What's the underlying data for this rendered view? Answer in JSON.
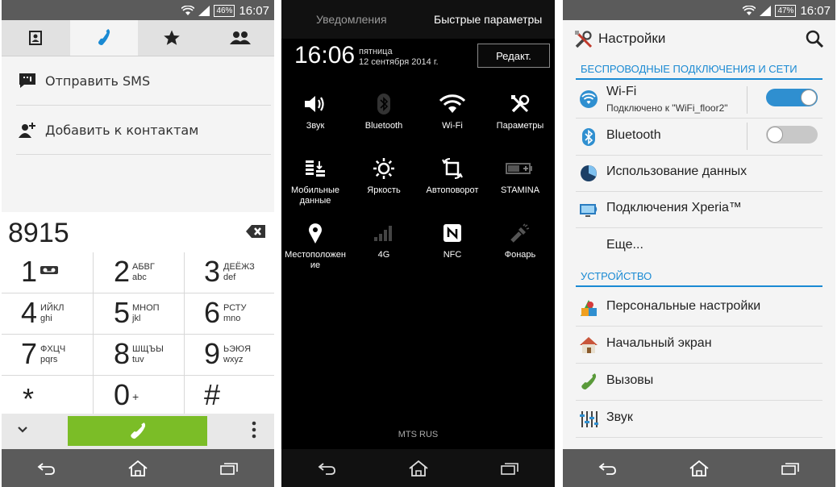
{
  "status": {
    "left": {
      "time": "16:07",
      "battery": "46%"
    },
    "right": {
      "time": "16:07",
      "battery": "47%"
    }
  },
  "dialer": {
    "tabs": [
      "contacts-icon",
      "phone-icon",
      "star-icon",
      "group-icon"
    ],
    "active_tab": "phone-icon",
    "actions": [
      {
        "label": "Отправить SMS",
        "icon": "sms-icon"
      },
      {
        "label": "Добавить к контактам",
        "icon": "add-contact-icon"
      }
    ],
    "number": "8915",
    "keys": [
      {
        "digit": "1",
        "letters": "",
        "extra": "voicemail-icon"
      },
      {
        "digit": "2",
        "letters": "АБВГ\nabc"
      },
      {
        "digit": "3",
        "letters": "ДЕЁЖЗ\ndef"
      },
      {
        "digit": "4",
        "letters": "ИЙКЛ\nghi"
      },
      {
        "digit": "5",
        "letters": "МНОП\njkl"
      },
      {
        "digit": "6",
        "letters": "РСТУ\nmno"
      },
      {
        "digit": "7",
        "letters": "ФХЦЧ\npqrs"
      },
      {
        "digit": "8",
        "letters": "ШЩЪЫ\ntuv"
      },
      {
        "digit": "9",
        "letters": "ЬЭЮЯ\nwxyz"
      },
      {
        "digit": "*",
        "letters": ""
      },
      {
        "digit": "0",
        "letters": "",
        "extra": "+"
      },
      {
        "digit": "#",
        "letters": ""
      }
    ],
    "call_color": "#7bbd27"
  },
  "quick": {
    "tab_notifications": "Уведомления",
    "tab_quick": "Быстрые параметры",
    "clock": "16:06",
    "weekday": "пятница",
    "date": "12 сентября 2014 г.",
    "edit": "Редакт.",
    "tiles": [
      {
        "label": "Звук",
        "icon": "volume-icon",
        "enabled": true
      },
      {
        "label": "Bluetooth",
        "icon": "bluetooth-icon",
        "enabled": false
      },
      {
        "label": "Wi-Fi",
        "icon": "wifi-icon",
        "enabled": true
      },
      {
        "label": "Параметры",
        "icon": "tools-icon",
        "enabled": true
      },
      {
        "label": "Мобильные\nданные",
        "icon": "mobile-data-icon",
        "enabled": true
      },
      {
        "label": "Яркость",
        "icon": "brightness-icon",
        "enabled": true
      },
      {
        "label": "Автоповорот",
        "icon": "rotate-icon",
        "enabled": true
      },
      {
        "label": "STAMINA",
        "icon": "battery-icon",
        "enabled": false
      },
      {
        "label": "Местоположен\nие",
        "icon": "location-icon",
        "enabled": true
      },
      {
        "label": "4G",
        "icon": "signal-icon",
        "enabled": false
      },
      {
        "label": "NFC",
        "icon": "nfc-icon",
        "enabled": true
      },
      {
        "label": "Фонарь",
        "icon": "flashlight-icon",
        "enabled": false
      }
    ],
    "operator": "MTS RUS"
  },
  "settings": {
    "title": "Настройки",
    "section_wireless": "БЕСПРОВОДНЫЕ ПОДКЛЮЧЕНИЯ И СЕТИ",
    "wifi": {
      "label": "Wi-Fi",
      "sub": "Подключено к \"WiFi_floor2\"",
      "on": true
    },
    "bluetooth": {
      "label": "Bluetooth",
      "on": false
    },
    "data_usage": "Использование данных",
    "xperia": "Подключения Xperia™",
    "more": "Еще...",
    "section_device": "УСТРОЙСТВО",
    "personal": "Персональные настройки",
    "home": "Начальный экран",
    "calls": "Вызовы",
    "sound": "Звук",
    "accent": "#1a8ad3"
  }
}
